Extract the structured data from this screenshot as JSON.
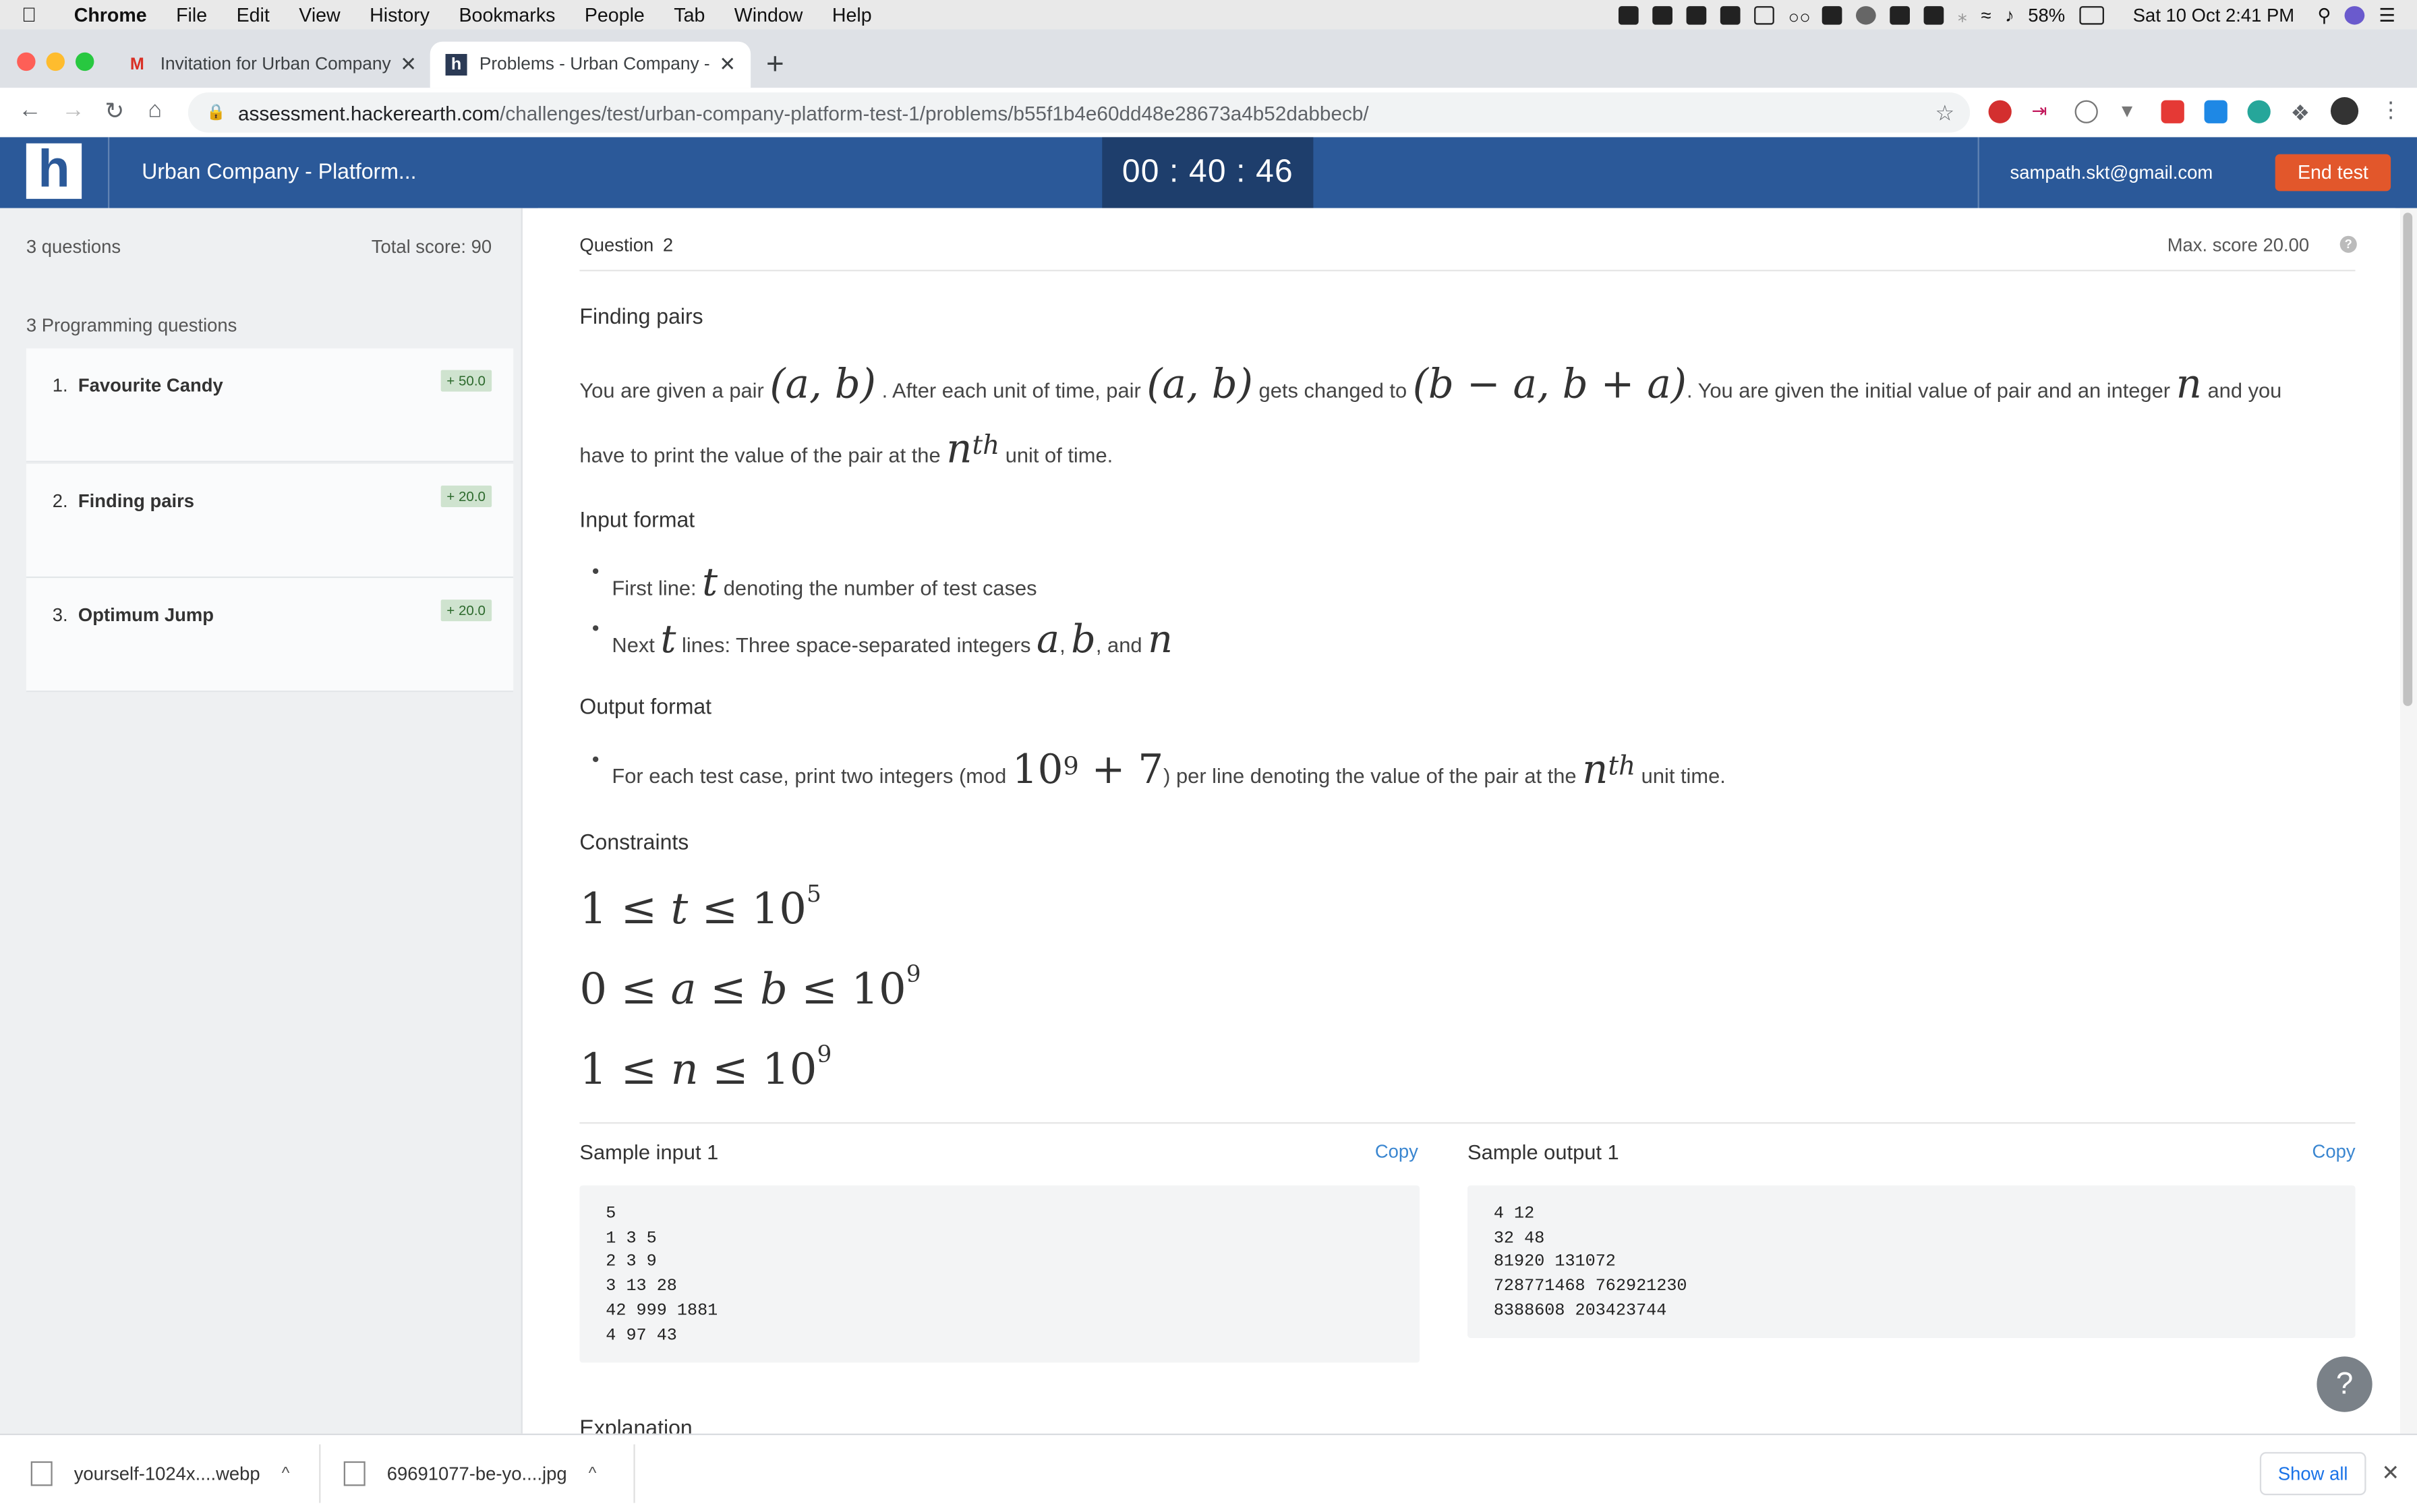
{
  "menubar": {
    "app": "Chrome",
    "items": [
      "File",
      "Edit",
      "View",
      "History",
      "Bookmarks",
      "People",
      "Tab",
      "Window",
      "Help"
    ],
    "battery": "58%",
    "datetime": "Sat 10 Oct  2:41 PM"
  },
  "tabs": [
    {
      "title": "Invitation for Urban Company -",
      "icon": "gmail-icon"
    },
    {
      "title": "Problems - Urban Company - F",
      "icon": "hackerearth-icon"
    }
  ],
  "address": {
    "host": "assessment.hackerearth.com",
    "path": "/challenges/test/urban-company-platform-test-1/problems/b55f1b4e60dd48e28673a4b52dabbecb/"
  },
  "header": {
    "logo": "h",
    "title": "Urban Company - Platform...",
    "timer": "00 : 40 : 46",
    "email": "sampath.skt@gmail.com",
    "end_test": "End test"
  },
  "sidebar": {
    "count": "3 questions",
    "total": "Total score: 90",
    "section": "3 Programming questions",
    "questions": [
      {
        "num": "1.",
        "title": "Favourite Candy",
        "score": "+ 50.0"
      },
      {
        "num": "2.",
        "title": "Finding pairs",
        "score": "+ 20.0"
      },
      {
        "num": "3.",
        "title": "Optimum Jump",
        "score": "+ 20.0"
      }
    ]
  },
  "question": {
    "label": "Question",
    "number": "2",
    "max_score": "Max. score 20.00",
    "title": "Finding pairs",
    "p1a": "You are given a pair ",
    "m_ab": "(a, b)",
    "p1b": " . After each unit of time, pair ",
    "p1c": " gets changed to ",
    "m_change": "(b − a, b + a)",
    "p1d": ". You are given the initial value of pair and an integer ",
    "m_n": "n",
    "p1e": " and you",
    "p2a": "have to print the value of the pair at the ",
    "m_nth_base": "n",
    "m_nth_sup": "th",
    "p2b": " unit of time.",
    "input_format": "Input format",
    "in1a": "First line: ",
    "m_t": "t",
    "in1b": " denoting the number of test cases",
    "in2a": "Next ",
    "in2b": " lines: Three space-separated integers ",
    "m_a": "a",
    "in2c": ", ",
    "m_b": "b",
    "in2d": ", and ",
    "output_format": "Output format",
    "out1a": "For each test case, print two integers (mod ",
    "m_mod_base": "10",
    "m_mod_sup": "9",
    "m_mod_rest": " + 7",
    "out1b": ") per line denoting the value of the pair at the ",
    "out1c": " unit time.",
    "constraints": "Constraints",
    "c1": {
      "pre": "1 ≤ ",
      "var": "t",
      "post": " ≤ 10",
      "sup": "5"
    },
    "c2": {
      "pre": "0 ≤ ",
      "var": "a",
      "mid": " ≤ ",
      "var2": "b",
      "post": " ≤ 10",
      "sup": "9"
    },
    "c3": {
      "pre": "1 ≤ ",
      "var": "n",
      "post": " ≤ 10",
      "sup": "9"
    },
    "sample_input_title": "Sample input 1",
    "sample_output_title": "Sample output 1",
    "copy": "Copy",
    "sample_input": "5\n1 3 5\n2 3 9\n3 13 28\n42 999 1881\n4 97 43",
    "sample_output": "4 12\n32 48\n81920 131072\n728771468 762921230\n8388608 203423744",
    "explanation": "Explanation"
  },
  "downloads": [
    {
      "name": "yourself-1024x....webp"
    },
    {
      "name": "69691077-be-yo....jpg"
    }
  ],
  "show_all": "Show all"
}
